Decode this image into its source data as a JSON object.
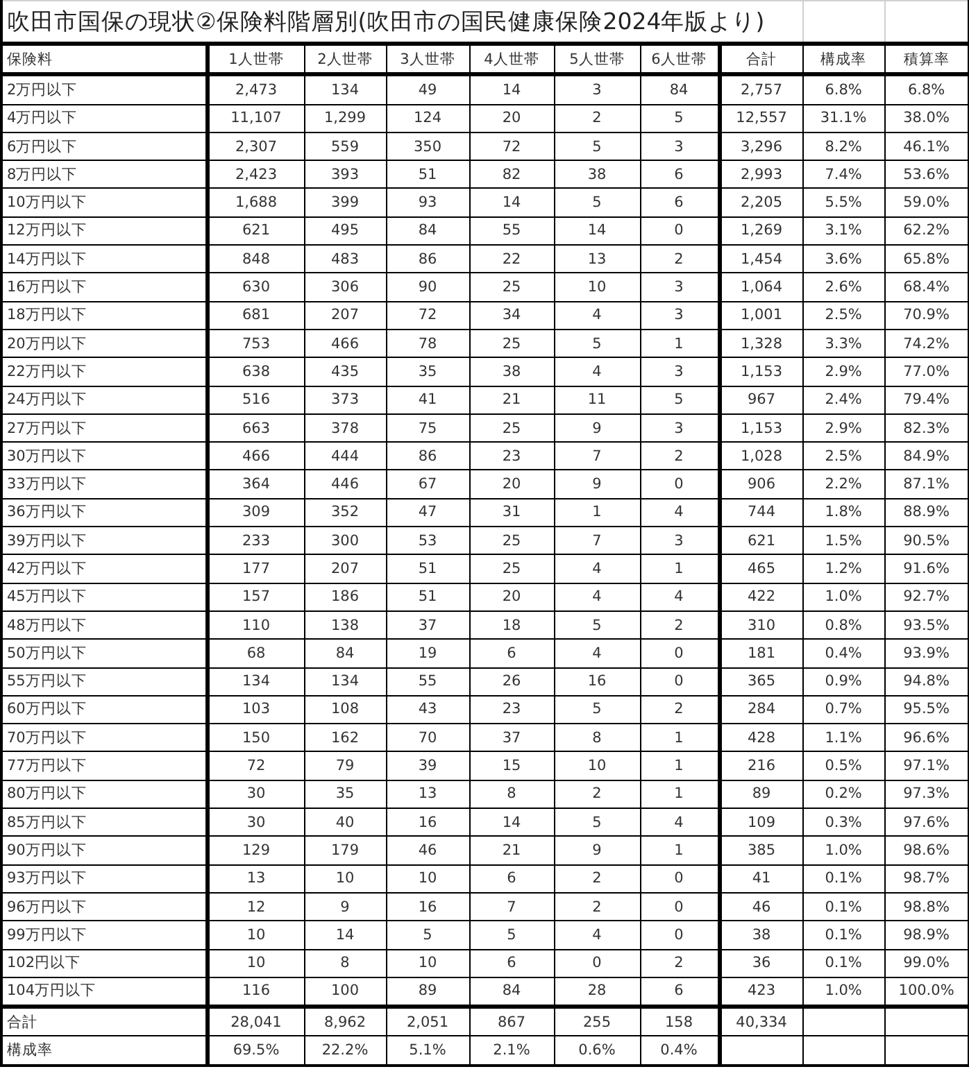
{
  "title": "吹田市国保の現状②保険料階層別(吹田市の国民健康保険2024年版より)",
  "columns": [
    "保険料",
    "1人世帯",
    "2人世帯",
    "3人世帯",
    "4人世帯",
    "5人世帯",
    "6人世帯",
    "合計",
    "構成率",
    "積算率"
  ],
  "rows": [
    {
      "label": "2万円以下",
      "cells": [
        "2,473",
        "134",
        "49",
        "14",
        "3",
        "84",
        "2,757",
        "6.8%",
        "6.8%"
      ]
    },
    {
      "label": "4万円以下",
      "cells": [
        "11,107",
        "1,299",
        "124",
        "20",
        "2",
        "5",
        "12,557",
        "31.1%",
        "38.0%"
      ]
    },
    {
      "label": "6万円以下",
      "cells": [
        "2,307",
        "559",
        "350",
        "72",
        "5",
        "3",
        "3,296",
        "8.2%",
        "46.1%"
      ]
    },
    {
      "label": "8万円以下",
      "cells": [
        "2,423",
        "393",
        "51",
        "82",
        "38",
        "6",
        "2,993",
        "7.4%",
        "53.6%"
      ]
    },
    {
      "label": "10万円以下",
      "cells": [
        "1,688",
        "399",
        "93",
        "14",
        "5",
        "6",
        "2,205",
        "5.5%",
        "59.0%"
      ]
    },
    {
      "label": "12万円以下",
      "cells": [
        "621",
        "495",
        "84",
        "55",
        "14",
        "0",
        "1,269",
        "3.1%",
        "62.2%"
      ]
    },
    {
      "label": "14万円以下",
      "cells": [
        "848",
        "483",
        "86",
        "22",
        "13",
        "2",
        "1,454",
        "3.6%",
        "65.8%"
      ]
    },
    {
      "label": "16万円以下",
      "cells": [
        "630",
        "306",
        "90",
        "25",
        "10",
        "3",
        "1,064",
        "2.6%",
        "68.4%"
      ]
    },
    {
      "label": "18万円以下",
      "cells": [
        "681",
        "207",
        "72",
        "34",
        "4",
        "3",
        "1,001",
        "2.5%",
        "70.9%"
      ]
    },
    {
      "label": "20万円以下",
      "cells": [
        "753",
        "466",
        "78",
        "25",
        "5",
        "1",
        "1,328",
        "3.3%",
        "74.2%"
      ]
    },
    {
      "label": "22万円以下",
      "cells": [
        "638",
        "435",
        "35",
        "38",
        "4",
        "3",
        "1,153",
        "2.9%",
        "77.0%"
      ]
    },
    {
      "label": "24万円以下",
      "cells": [
        "516",
        "373",
        "41",
        "21",
        "11",
        "5",
        "967",
        "2.4%",
        "79.4%"
      ]
    },
    {
      "label": "27万円以下",
      "cells": [
        "663",
        "378",
        "75",
        "25",
        "9",
        "3",
        "1,153",
        "2.9%",
        "82.3%"
      ]
    },
    {
      "label": "30万円以下",
      "cells": [
        "466",
        "444",
        "86",
        "23",
        "7",
        "2",
        "1,028",
        "2.5%",
        "84.9%"
      ]
    },
    {
      "label": "33万円以下",
      "cells": [
        "364",
        "446",
        "67",
        "20",
        "9",
        "0",
        "906",
        "2.2%",
        "87.1%"
      ]
    },
    {
      "label": "36万円以下",
      "cells": [
        "309",
        "352",
        "47",
        "31",
        "1",
        "4",
        "744",
        "1.8%",
        "88.9%"
      ]
    },
    {
      "label": "39万円以下",
      "cells": [
        "233",
        "300",
        "53",
        "25",
        "7",
        "3",
        "621",
        "1.5%",
        "90.5%"
      ]
    },
    {
      "label": "42万円以下",
      "cells": [
        "177",
        "207",
        "51",
        "25",
        "4",
        "1",
        "465",
        "1.2%",
        "91.6%"
      ]
    },
    {
      "label": "45万円以下",
      "cells": [
        "157",
        "186",
        "51",
        "20",
        "4",
        "4",
        "422",
        "1.0%",
        "92.7%"
      ]
    },
    {
      "label": "48万円以下",
      "cells": [
        "110",
        "138",
        "37",
        "18",
        "5",
        "2",
        "310",
        "0.8%",
        "93.5%"
      ]
    },
    {
      "label": "50万円以下",
      "cells": [
        "68",
        "84",
        "19",
        "6",
        "4",
        "0",
        "181",
        "0.4%",
        "93.9%"
      ]
    },
    {
      "label": "55万円以下",
      "cells": [
        "134",
        "134",
        "55",
        "26",
        "16",
        "0",
        "365",
        "0.9%",
        "94.8%"
      ]
    },
    {
      "label": "60万円以下",
      "cells": [
        "103",
        "108",
        "43",
        "23",
        "5",
        "2",
        "284",
        "0.7%",
        "95.5%"
      ]
    },
    {
      "label": "70万円以下",
      "cells": [
        "150",
        "162",
        "70",
        "37",
        "8",
        "1",
        "428",
        "1.1%",
        "96.6%"
      ]
    },
    {
      "label": "77万円以下",
      "cells": [
        "72",
        "79",
        "39",
        "15",
        "10",
        "1",
        "216",
        "0.5%",
        "97.1%"
      ]
    },
    {
      "label": "80万円以下",
      "cells": [
        "30",
        "35",
        "13",
        "8",
        "2",
        "1",
        "89",
        "0.2%",
        "97.3%"
      ]
    },
    {
      "label": "85万円以下",
      "cells": [
        "30",
        "40",
        "16",
        "14",
        "5",
        "4",
        "109",
        "0.3%",
        "97.6%"
      ]
    },
    {
      "label": "90万円以下",
      "cells": [
        "129",
        "179",
        "46",
        "21",
        "9",
        "1",
        "385",
        "1.0%",
        "98.6%"
      ]
    },
    {
      "label": "93万円以下",
      "cells": [
        "13",
        "10",
        "10",
        "6",
        "2",
        "0",
        "41",
        "0.1%",
        "98.7%"
      ]
    },
    {
      "label": "96万円以下",
      "cells": [
        "12",
        "9",
        "16",
        "7",
        "2",
        "0",
        "46",
        "0.1%",
        "98.8%"
      ]
    },
    {
      "label": "99万円以下",
      "cells": [
        "10",
        "14",
        "5",
        "5",
        "4",
        "0",
        "38",
        "0.1%",
        "98.9%"
      ]
    },
    {
      "label": "102円以下",
      "cells": [
        "10",
        "8",
        "10",
        "6",
        "0",
        "2",
        "36",
        "0.1%",
        "99.0%"
      ]
    },
    {
      "label": "104万円以下",
      "cells": [
        "116",
        "100",
        "89",
        "84",
        "28",
        "6",
        "423",
        "1.0%",
        "100.0%"
      ]
    }
  ],
  "footer_rows": [
    {
      "label": "合計",
      "cells": [
        "28,041",
        "8,962",
        "2,051",
        "867",
        "255",
        "158",
        "40,334"
      ]
    },
    {
      "label": "構成率",
      "cells": [
        "69.5%",
        "22.2%",
        "5.1%",
        "2.1%",
        "0.6%",
        "0.4%"
      ]
    }
  ]
}
